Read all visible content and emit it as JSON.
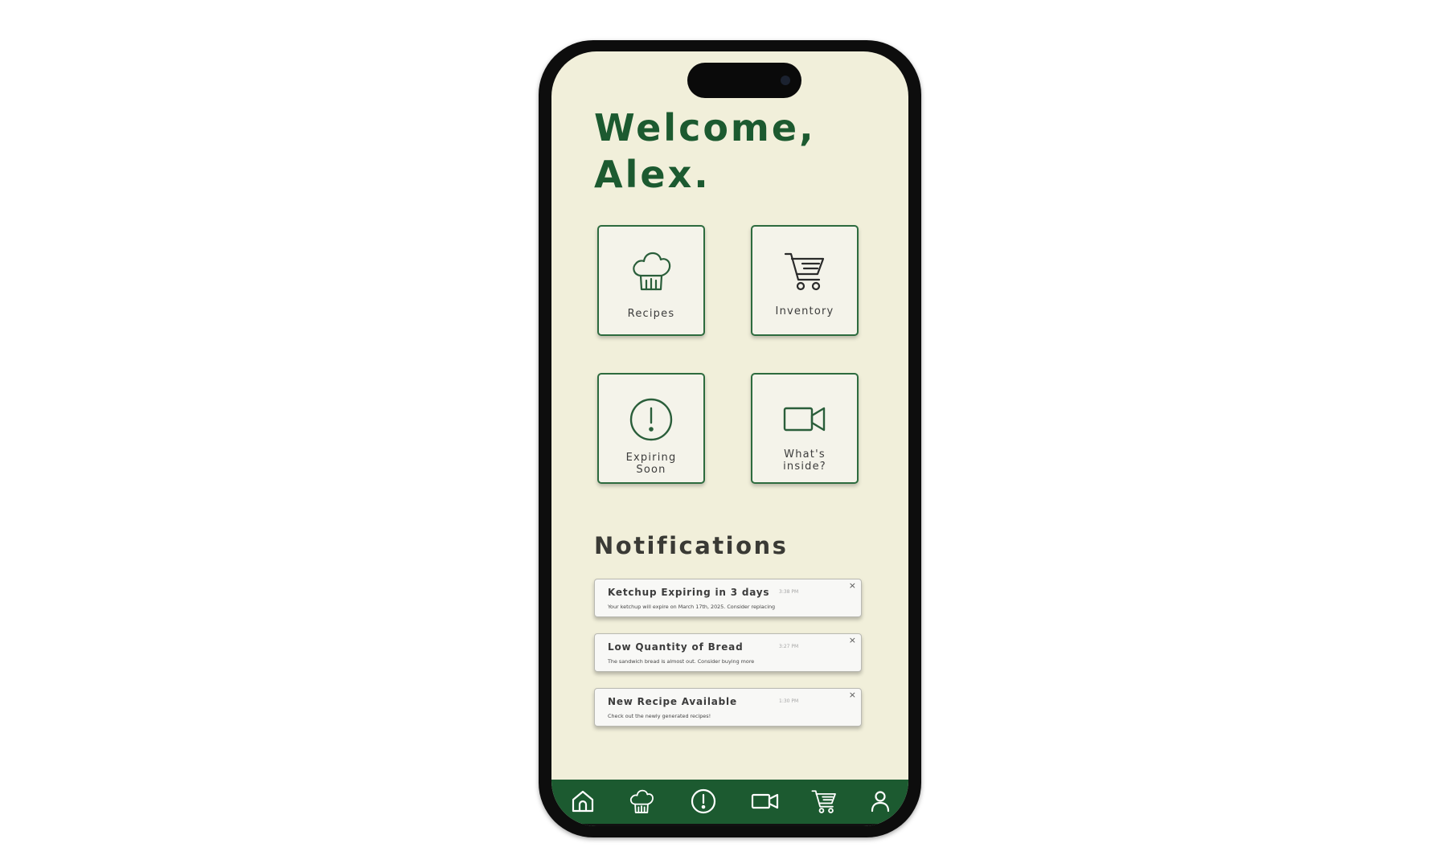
{
  "welcome": {
    "line1": "Welcome,",
    "line2": "Alex."
  },
  "tiles": [
    {
      "label": "Recipes",
      "icon": "chef-hat-icon"
    },
    {
      "label": "Inventory",
      "icon": "shopping-cart-icon"
    },
    {
      "label_line1": "Expiring",
      "label_line2": "Soon",
      "icon": "alert-circle-icon"
    },
    {
      "label_line1": "What's",
      "label_line2": "inside?",
      "icon": "video-camera-icon"
    }
  ],
  "notifications": {
    "heading": "Notifications",
    "items": [
      {
        "title": "Ketchup Expiring in 3 days",
        "time": "3:38 PM",
        "body": "Your ketchup will expire on March 17th, 2025. Consider replacing",
        "close": "×"
      },
      {
        "title": "Low Quantity of Bread",
        "time": "3:27 PM",
        "body": "The sandwich bread is almost out. Consider buying more",
        "close": "×"
      },
      {
        "title": "New Recipe Available",
        "time": "1:30 PM",
        "body": "Check out the newly generated recipes!",
        "close": "×"
      }
    ]
  },
  "bottom_nav": [
    {
      "icon": "home-icon"
    },
    {
      "icon": "chef-hat-icon"
    },
    {
      "icon": "alert-circle-icon"
    },
    {
      "icon": "video-camera-icon"
    },
    {
      "icon": "shopping-cart-icon"
    },
    {
      "icon": "user-icon"
    }
  ],
  "colors": {
    "brand_green": "#1c5a30",
    "screen_background": "#f1efda",
    "tile_border": "#2d6b3e"
  }
}
